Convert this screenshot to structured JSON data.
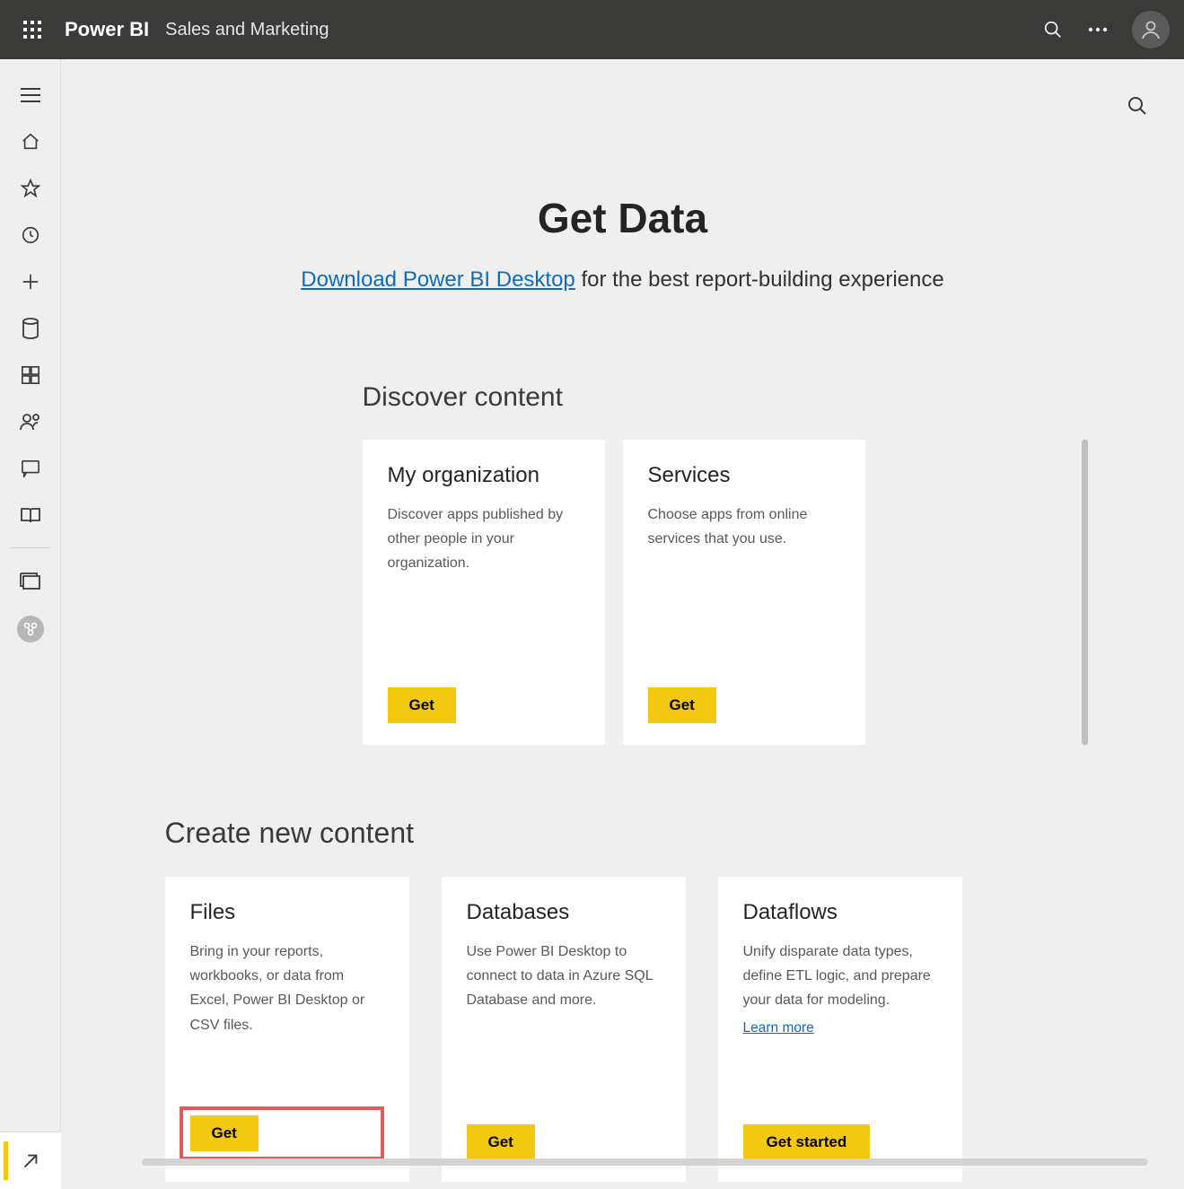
{
  "header": {
    "brand": "Power BI",
    "workspace": "Sales and Marketing"
  },
  "hero": {
    "title": "Get Data",
    "link_text": "Download Power BI Desktop",
    "suffix_text": " for the best report-building experience"
  },
  "discover": {
    "title": "Discover content",
    "cards": [
      {
        "title": "My organization",
        "desc": "Discover apps published by other people in your organization.",
        "button": "Get"
      },
      {
        "title": "Services",
        "desc": "Choose apps from online services that you use.",
        "button": "Get"
      }
    ]
  },
  "create": {
    "title": "Create new content",
    "cards": [
      {
        "title": "Files",
        "desc": "Bring in your reports, workbooks, or data from Excel, Power BI Desktop or CSV files.",
        "button": "Get"
      },
      {
        "title": "Databases",
        "desc": "Use Power BI Desktop to connect to data in Azure SQL Database and more.",
        "button": "Get"
      },
      {
        "title": "Dataflows",
        "desc": "Unify disparate data types, define ETL logic, and prepare your data for modeling.",
        "learn_more": "Learn more",
        "button": "Get started"
      }
    ]
  }
}
